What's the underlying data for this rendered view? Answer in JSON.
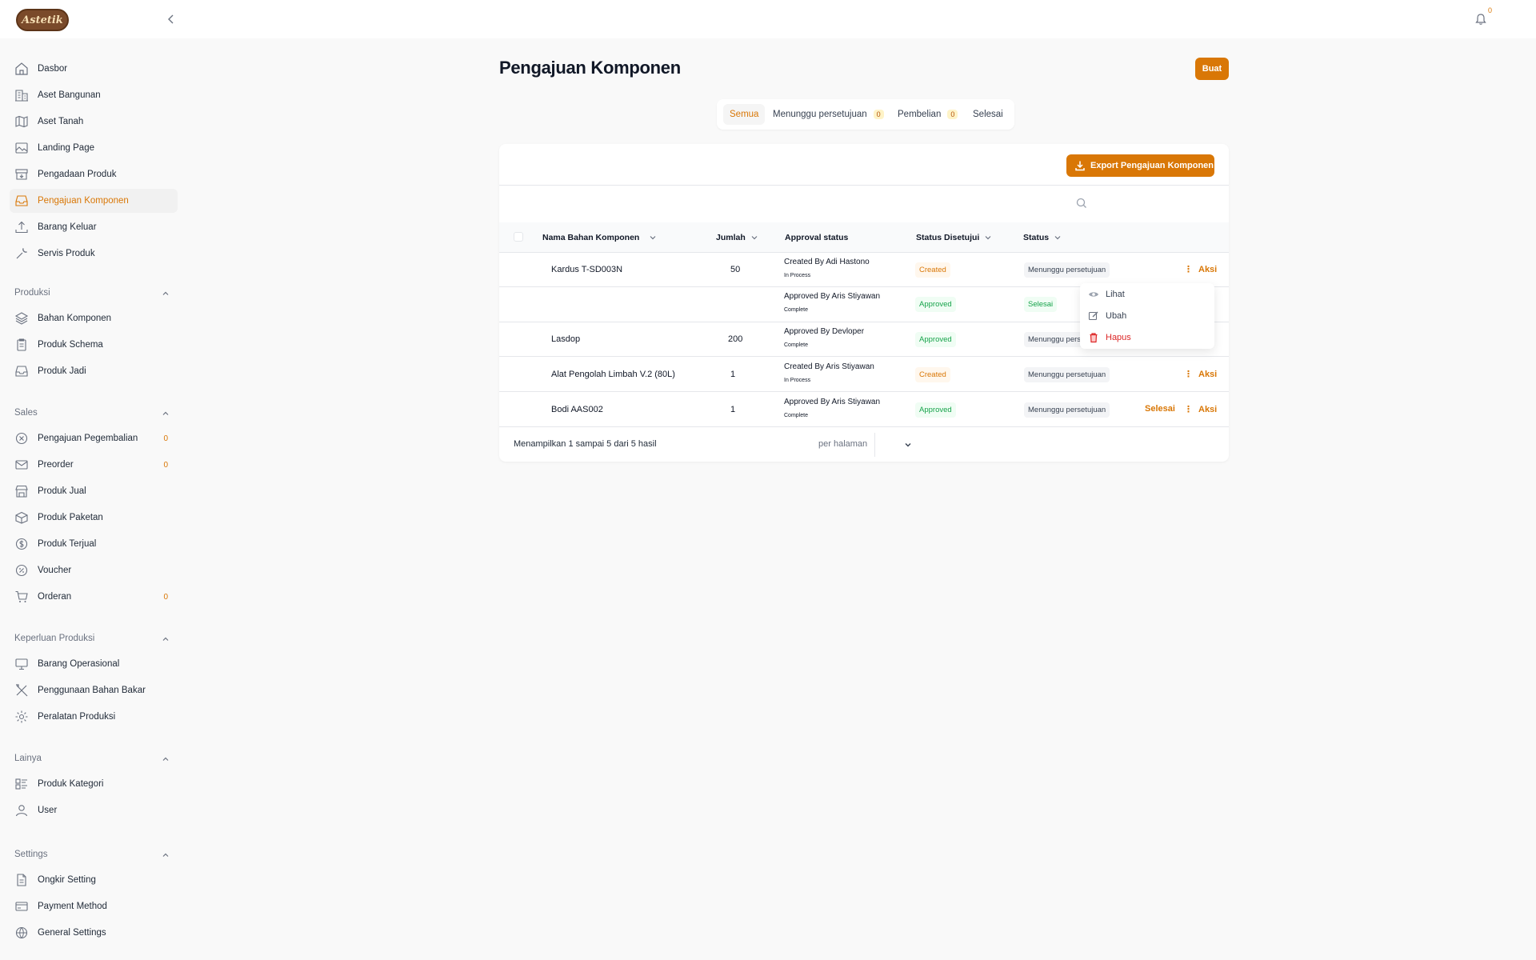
{
  "app": {
    "logo_text": "Astetik",
    "notification_count": "0"
  },
  "sidebar": {
    "main_items": [
      {
        "label": "Dasbor",
        "icon": "home-icon"
      },
      {
        "label": "Aset Bangunan",
        "icon": "building-icon"
      },
      {
        "label": "Aset Tanah",
        "icon": "map-icon"
      },
      {
        "label": "Landing Page",
        "icon": "image-icon"
      },
      {
        "label": "Pengadaan Produk",
        "icon": "archive-icon"
      },
      {
        "label": "Pengajuan Komponen",
        "icon": "inbox-icon",
        "active": true
      },
      {
        "label": "Barang Keluar",
        "icon": "upload-icon"
      },
      {
        "label": "Servis Produk",
        "icon": "wrench-icon"
      }
    ],
    "sections": [
      {
        "label": "Produksi",
        "items": [
          {
            "label": "Bahan Komponen",
            "icon": "layers-icon"
          },
          {
            "label": "Produk Schema",
            "icon": "clipboard-icon"
          },
          {
            "label": "Produk Jadi",
            "icon": "inbox-icon"
          }
        ]
      },
      {
        "label": "Sales",
        "items": [
          {
            "label": "Pengajuan Pegembalian",
            "icon": "x-circle-icon",
            "badge": "0"
          },
          {
            "label": "Preorder",
            "icon": "mail-icon",
            "badge": "0"
          },
          {
            "label": "Produk Jual",
            "icon": "store-icon"
          },
          {
            "label": "Produk Paketan",
            "icon": "package-icon"
          },
          {
            "label": "Produk Terjual",
            "icon": "dollar-circle-icon"
          },
          {
            "label": "Voucher",
            "icon": "percent-circle-icon"
          },
          {
            "label": "Orderan",
            "icon": "cart-icon",
            "badge": "0"
          }
        ]
      },
      {
        "label": "Keperluan Produksi",
        "items": [
          {
            "label": "Barang Operasional",
            "icon": "monitor-icon"
          },
          {
            "label": "Penggunaan Bahan Bakar",
            "icon": "tools-icon"
          },
          {
            "label": "Peralatan Produksi",
            "icon": "gear-icon"
          }
        ]
      },
      {
        "label": "Lainya",
        "items": [
          {
            "label": "Produk Kategori",
            "icon": "category-icon"
          },
          {
            "label": "User",
            "icon": "user-icon"
          }
        ]
      },
      {
        "label": "Settings",
        "items": [
          {
            "label": "Ongkir Setting",
            "icon": "document-icon"
          },
          {
            "label": "Payment Method",
            "icon": "credit-card-icon"
          },
          {
            "label": "General Settings",
            "icon": "globe-icon"
          }
        ]
      }
    ]
  },
  "page": {
    "title": "Pengajuan Komponen",
    "create_label": "Buat",
    "tabs": [
      {
        "label": "Semua",
        "active": true
      },
      {
        "label": "Menunggu persetujuan",
        "badge": "0"
      },
      {
        "label": "Pembelian",
        "badge": "0"
      },
      {
        "label": "Selesai"
      }
    ],
    "export_label": "Export Pengajuan Komponen",
    "search_placeholder": ""
  },
  "table": {
    "columns": [
      "Nama Bahan Komponen",
      "Jumlah",
      "Approval status",
      "Status Disetujui",
      "Status"
    ],
    "rows": [
      {
        "name": "Kardus T-SD003N",
        "qty": "50",
        "approval_by": "Created By Adi Hastono",
        "approval_state": "In Process",
        "status_disetujui": "Created",
        "status": "Menunggu persetujuan",
        "aksi": "Aksi"
      },
      {
        "name": "",
        "qty": "",
        "approval_by": "Approved By Aris Stiyawan",
        "approval_state": "Complete",
        "status_disetujui": "Approved",
        "status": "Selesai",
        "aksi": ""
      },
      {
        "name": "Lasdop",
        "qty": "200",
        "approval_by": "Approved By Devloper",
        "approval_state": "Complete",
        "status_disetujui": "Approved",
        "status": "Menunggu pers",
        "aksi": ""
      },
      {
        "name": "Alat Pengolah Limbah V.2 (80L)",
        "qty": "1",
        "approval_by": "Created By Aris Stiyawan",
        "approval_state": "In Process",
        "status_disetujui": "Created",
        "status": "Menunggu persetujuan",
        "aksi": "Aksi"
      },
      {
        "name": "Bodi AAS002",
        "qty": "1",
        "approval_by": "Approved By Aris Stiyawan",
        "approval_state": "Complete",
        "status_disetujui": "Approved",
        "status": "Menunggu persetujuan",
        "selesai": "Selesai",
        "aksi": "Aksi"
      }
    ],
    "dropdown": [
      "Lihat",
      "Ubah",
      "Hapus"
    ],
    "footer": "Menampilkan 1 sampai 5 dari 5 hasil",
    "per_page_label": "per halaman"
  },
  "colors": {
    "accent": "#d97706",
    "approved": "#16a34a",
    "danger": "#dc2626"
  }
}
